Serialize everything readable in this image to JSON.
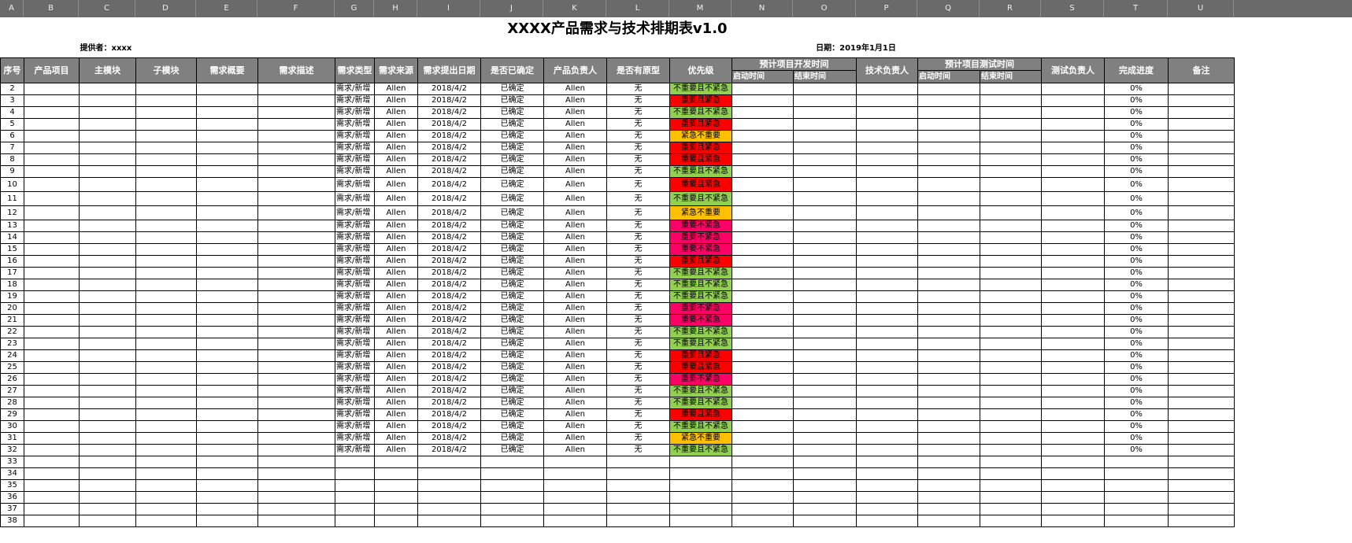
{
  "columns": [
    "A",
    "B",
    "C",
    "D",
    "E",
    "F",
    "G",
    "H",
    "I",
    "J",
    "K",
    "L",
    "M",
    "N",
    "O",
    "P",
    "Q",
    "R",
    "S",
    "T",
    "U"
  ],
  "title": "XXXX产品需求与技术排期表v1.0",
  "provider": "提供者：xxxx",
  "date": "日期：2019年1月1日",
  "header": {
    "seq": "序号",
    "project": "产品项目",
    "main_module": "主模块",
    "sub_module": "子模块",
    "summary": "需求概要",
    "description": "需求描述",
    "type": "需求类型",
    "source": "需求来源",
    "raised_date": "需求提出日期",
    "confirmed": "是否已确定",
    "pm": "产品负责人",
    "prototype": "是否有原型",
    "priority": "优先级",
    "dev_time": "预计项目开发时间",
    "dev_start": "启动时间",
    "dev_end": "结束时间",
    "tech_owner": "技术负责人",
    "test_time": "预计项目测试时间",
    "test_start": "启动时间",
    "test_end": "结束时间",
    "test_owner": "测试负责人",
    "progress": "完成进度",
    "notes": "备注"
  },
  "rows": [
    {
      "n": "2",
      "type": "需求/新增",
      "source": "Allen",
      "date": "2018/4/2",
      "confirmed": "已确定",
      "pm": "Allen",
      "proto": "无",
      "priority": "不重要且不紧急",
      "p": "g",
      "progress": "0%"
    },
    {
      "n": "3",
      "type": "需求/新增",
      "source": "Allen",
      "date": "2018/4/2",
      "confirmed": "已确定",
      "pm": "Allen",
      "proto": "无",
      "priority": "重要且紧急",
      "p": "r",
      "progress": "0%"
    },
    {
      "n": "4",
      "type": "需求/新增",
      "source": "Allen",
      "date": "2018/4/2",
      "confirmed": "已确定",
      "pm": "Allen",
      "proto": "无",
      "priority": "不重要且不紧急",
      "p": "g",
      "progress": "0%"
    },
    {
      "n": "5",
      "type": "需求/新增",
      "source": "Allen",
      "date": "2018/4/2",
      "confirmed": "已确定",
      "pm": "Allen",
      "proto": "无",
      "priority": "重要且紧急",
      "p": "r",
      "progress": "0%"
    },
    {
      "n": "6",
      "type": "需求/新增",
      "source": "Allen",
      "date": "2018/4/2",
      "confirmed": "已确定",
      "pm": "Allen",
      "proto": "无",
      "priority": "紧急不重要",
      "p": "y",
      "progress": "0%"
    },
    {
      "n": "7",
      "type": "需求/新增",
      "source": "Allen",
      "date": "2018/4/2",
      "confirmed": "已确定",
      "pm": "Allen",
      "proto": "无",
      "priority": "重要且紧急",
      "p": "r",
      "progress": "0%"
    },
    {
      "n": "8",
      "type": "需求/新增",
      "source": "Allen",
      "date": "2018/4/2",
      "confirmed": "已确定",
      "pm": "Allen",
      "proto": "无",
      "priority": "重要且紧急",
      "p": "r",
      "progress": "0%"
    },
    {
      "n": "9",
      "type": "需求/新增",
      "source": "Allen",
      "date": "2018/4/2",
      "confirmed": "已确定",
      "pm": "Allen",
      "proto": "无",
      "priority": "不重要且不紧急",
      "p": "g",
      "progress": "0%"
    },
    {
      "n": "10",
      "type": "需求/新增",
      "source": "Allen",
      "date": "2018/4/2",
      "confirmed": "已确定",
      "pm": "Allen",
      "proto": "无",
      "priority": "重要且紧急",
      "p": "r",
      "progress": "0%"
    },
    {
      "n": "11",
      "type": "需求/新增",
      "source": "Allen",
      "date": "2018/4/2",
      "confirmed": "已确定",
      "pm": "Allen",
      "proto": "无",
      "priority": "不重要且不紧急",
      "p": "g",
      "progress": "0%"
    },
    {
      "n": "12",
      "type": "需求/新增",
      "source": "Allen",
      "date": "2018/4/2",
      "confirmed": "已确定",
      "pm": "Allen",
      "proto": "无",
      "priority": "紧急不重要",
      "p": "y",
      "progress": "0%"
    },
    {
      "n": "13",
      "type": "需求/新增",
      "source": "Allen",
      "date": "2018/4/2",
      "confirmed": "已确定",
      "pm": "Allen",
      "proto": "无",
      "priority": "重要不紧急",
      "p": "m",
      "progress": "0%"
    },
    {
      "n": "14",
      "type": "需求/新增",
      "source": "Allen",
      "date": "2018/4/2",
      "confirmed": "已确定",
      "pm": "Allen",
      "proto": "无",
      "priority": "重要不紧急",
      "p": "m",
      "progress": "0%"
    },
    {
      "n": "15",
      "type": "需求/新增",
      "source": "Allen",
      "date": "2018/4/2",
      "confirmed": "已确定",
      "pm": "Allen",
      "proto": "无",
      "priority": "重要不紧急",
      "p": "m",
      "progress": "0%"
    },
    {
      "n": "16",
      "type": "需求/新增",
      "source": "Allen",
      "date": "2018/4/2",
      "confirmed": "已确定",
      "pm": "Allen",
      "proto": "无",
      "priority": "重要且紧急",
      "p": "r",
      "progress": "0%"
    },
    {
      "n": "17",
      "type": "需求/新增",
      "source": "Allen",
      "date": "2018/4/2",
      "confirmed": "已确定",
      "pm": "Allen",
      "proto": "无",
      "priority": "不重要且不紧急",
      "p": "g",
      "progress": "0%"
    },
    {
      "n": "18",
      "type": "需求/新增",
      "source": "Allen",
      "date": "2018/4/2",
      "confirmed": "已确定",
      "pm": "Allen",
      "proto": "无",
      "priority": "不重要且不紧急",
      "p": "g",
      "progress": "0%"
    },
    {
      "n": "19",
      "type": "需求/新增",
      "source": "Allen",
      "date": "2018/4/2",
      "confirmed": "已确定",
      "pm": "Allen",
      "proto": "无",
      "priority": "不重要且不紧急",
      "p": "g",
      "progress": "0%"
    },
    {
      "n": "20",
      "type": "需求/新增",
      "source": "Allen",
      "date": "2018/4/2",
      "confirmed": "已确定",
      "pm": "Allen",
      "proto": "无",
      "priority": "重要不紧急",
      "p": "m",
      "progress": "0%"
    },
    {
      "n": "21",
      "type": "需求/新增",
      "source": "Allen",
      "date": "2018/4/2",
      "confirmed": "已确定",
      "pm": "Allen",
      "proto": "无",
      "priority": "重要不紧急",
      "p": "m",
      "progress": "0%"
    },
    {
      "n": "22",
      "type": "需求/新增",
      "source": "Allen",
      "date": "2018/4/2",
      "confirmed": "已确定",
      "pm": "Allen",
      "proto": "无",
      "priority": "不重要且不紧急",
      "p": "g",
      "progress": "0%"
    },
    {
      "n": "23",
      "type": "需求/新增",
      "source": "Allen",
      "date": "2018/4/2",
      "confirmed": "已确定",
      "pm": "Allen",
      "proto": "无",
      "priority": "不重要且不紧急",
      "p": "g",
      "progress": "0%"
    },
    {
      "n": "24",
      "type": "需求/新增",
      "source": "Allen",
      "date": "2018/4/2",
      "confirmed": "已确定",
      "pm": "Allen",
      "proto": "无",
      "priority": "重要且紧急",
      "p": "r",
      "progress": "0%"
    },
    {
      "n": "25",
      "type": "需求/新增",
      "source": "Allen",
      "date": "2018/4/2",
      "confirmed": "已确定",
      "pm": "Allen",
      "proto": "无",
      "priority": "重要且紧急",
      "p": "r",
      "progress": "0%"
    },
    {
      "n": "26",
      "type": "需求/新增",
      "source": "Allen",
      "date": "2018/4/2",
      "confirmed": "已确定",
      "pm": "Allen",
      "proto": "无",
      "priority": "重要不紧急",
      "p": "m",
      "progress": "0%"
    },
    {
      "n": "27",
      "type": "需求/新增",
      "source": "Allen",
      "date": "2018/4/2",
      "confirmed": "已确定",
      "pm": "Allen",
      "proto": "无",
      "priority": "不重要且不紧急",
      "p": "g",
      "progress": "0%"
    },
    {
      "n": "28",
      "type": "需求/新增",
      "source": "Allen",
      "date": "2018/4/2",
      "confirmed": "已确定",
      "pm": "Allen",
      "proto": "无",
      "priority": "不重要且不紧急",
      "p": "g",
      "progress": "0%"
    },
    {
      "n": "29",
      "type": "需求/新增",
      "source": "Allen",
      "date": "2018/4/2",
      "confirmed": "已确定",
      "pm": "Allen",
      "proto": "无",
      "priority": "重要且紧急",
      "p": "r",
      "progress": "0%"
    },
    {
      "n": "30",
      "type": "需求/新增",
      "source": "Allen",
      "date": "2018/4/2",
      "confirmed": "已确定",
      "pm": "Allen",
      "proto": "无",
      "priority": "不重要且不紧急",
      "p": "g",
      "progress": "0%"
    },
    {
      "n": "31",
      "type": "需求/新增",
      "source": "Allen",
      "date": "2018/4/2",
      "confirmed": "已确定",
      "pm": "Allen",
      "proto": "无",
      "priority": "紧急不重要",
      "p": "y",
      "progress": "0%"
    },
    {
      "n": "32",
      "type": "需求/新增",
      "source": "Allen",
      "date": "2018/4/2",
      "confirmed": "已确定",
      "pm": "Allen",
      "proto": "无",
      "priority": "不重要且不紧急",
      "p": "g",
      "progress": "0%"
    }
  ],
  "empty_rows": [
    "33",
    "34",
    "35",
    "36",
    "37",
    "38"
  ],
  "colors": {
    "green": "#92d050",
    "red": "#ff0000",
    "yellow": "#ffc000",
    "magenta": "#ff0066",
    "header_gray": "#808080"
  }
}
